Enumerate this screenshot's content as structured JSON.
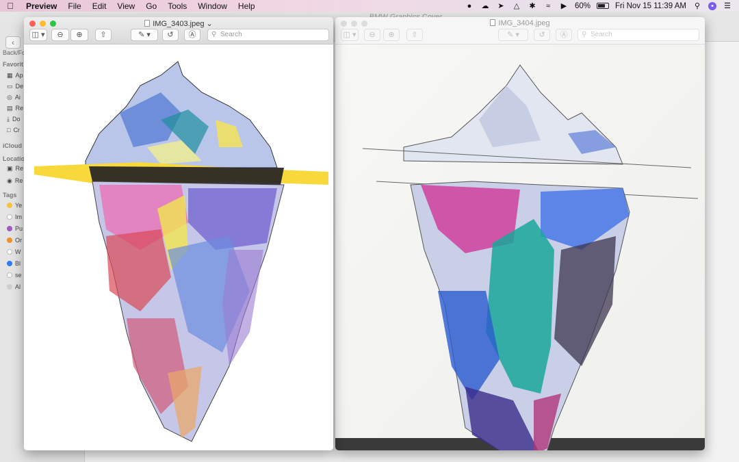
{
  "menubar": {
    "apple_icon": "apple-logo-icon",
    "app_name": "Preview",
    "menus": [
      "File",
      "Edit",
      "View",
      "Go",
      "Tools",
      "Window",
      "Help"
    ],
    "battery_percent": "60%",
    "datetime": "Fri Nov 15  11:39 AM"
  },
  "finder": {
    "title": "BMW Graphics Cover",
    "back_label": "Back/Fo",
    "sections": {
      "favorites": "Favorit",
      "icloud": "iCloud",
      "locations": "Location",
      "tags": "Tags"
    },
    "favorites": [
      "Ap",
      "De",
      "Ai",
      "Re",
      "Do",
      "Cr"
    ],
    "locations": [
      "Re",
      "Re"
    ],
    "tags": [
      {
        "label": "Ye",
        "color": "#f5c242"
      },
      {
        "label": "Im",
        "color": "#d8d8d8"
      },
      {
        "label": "Pu",
        "color": "#a35bc3"
      },
      {
        "label": "Or",
        "color": "#f0902c"
      },
      {
        "label": "W",
        "color": "#d8d8d8"
      },
      {
        "label": "Bl",
        "color": "#2f7df6"
      },
      {
        "label": "se",
        "color": "#d8d8d8"
      },
      {
        "label": "Al",
        "color": "#cfcfcf"
      }
    ]
  },
  "preview_left": {
    "title": "IMG_3403.jpeg",
    "search_placeholder": "Search"
  },
  "preview_right": {
    "title": "IMG_3404.jpeg",
    "search_placeholder": "Search"
  },
  "colors": {
    "close": "#fd5f57",
    "minimize": "#febb2e",
    "zoom": "#28c840",
    "inactive_light": "#dcdcdc"
  }
}
